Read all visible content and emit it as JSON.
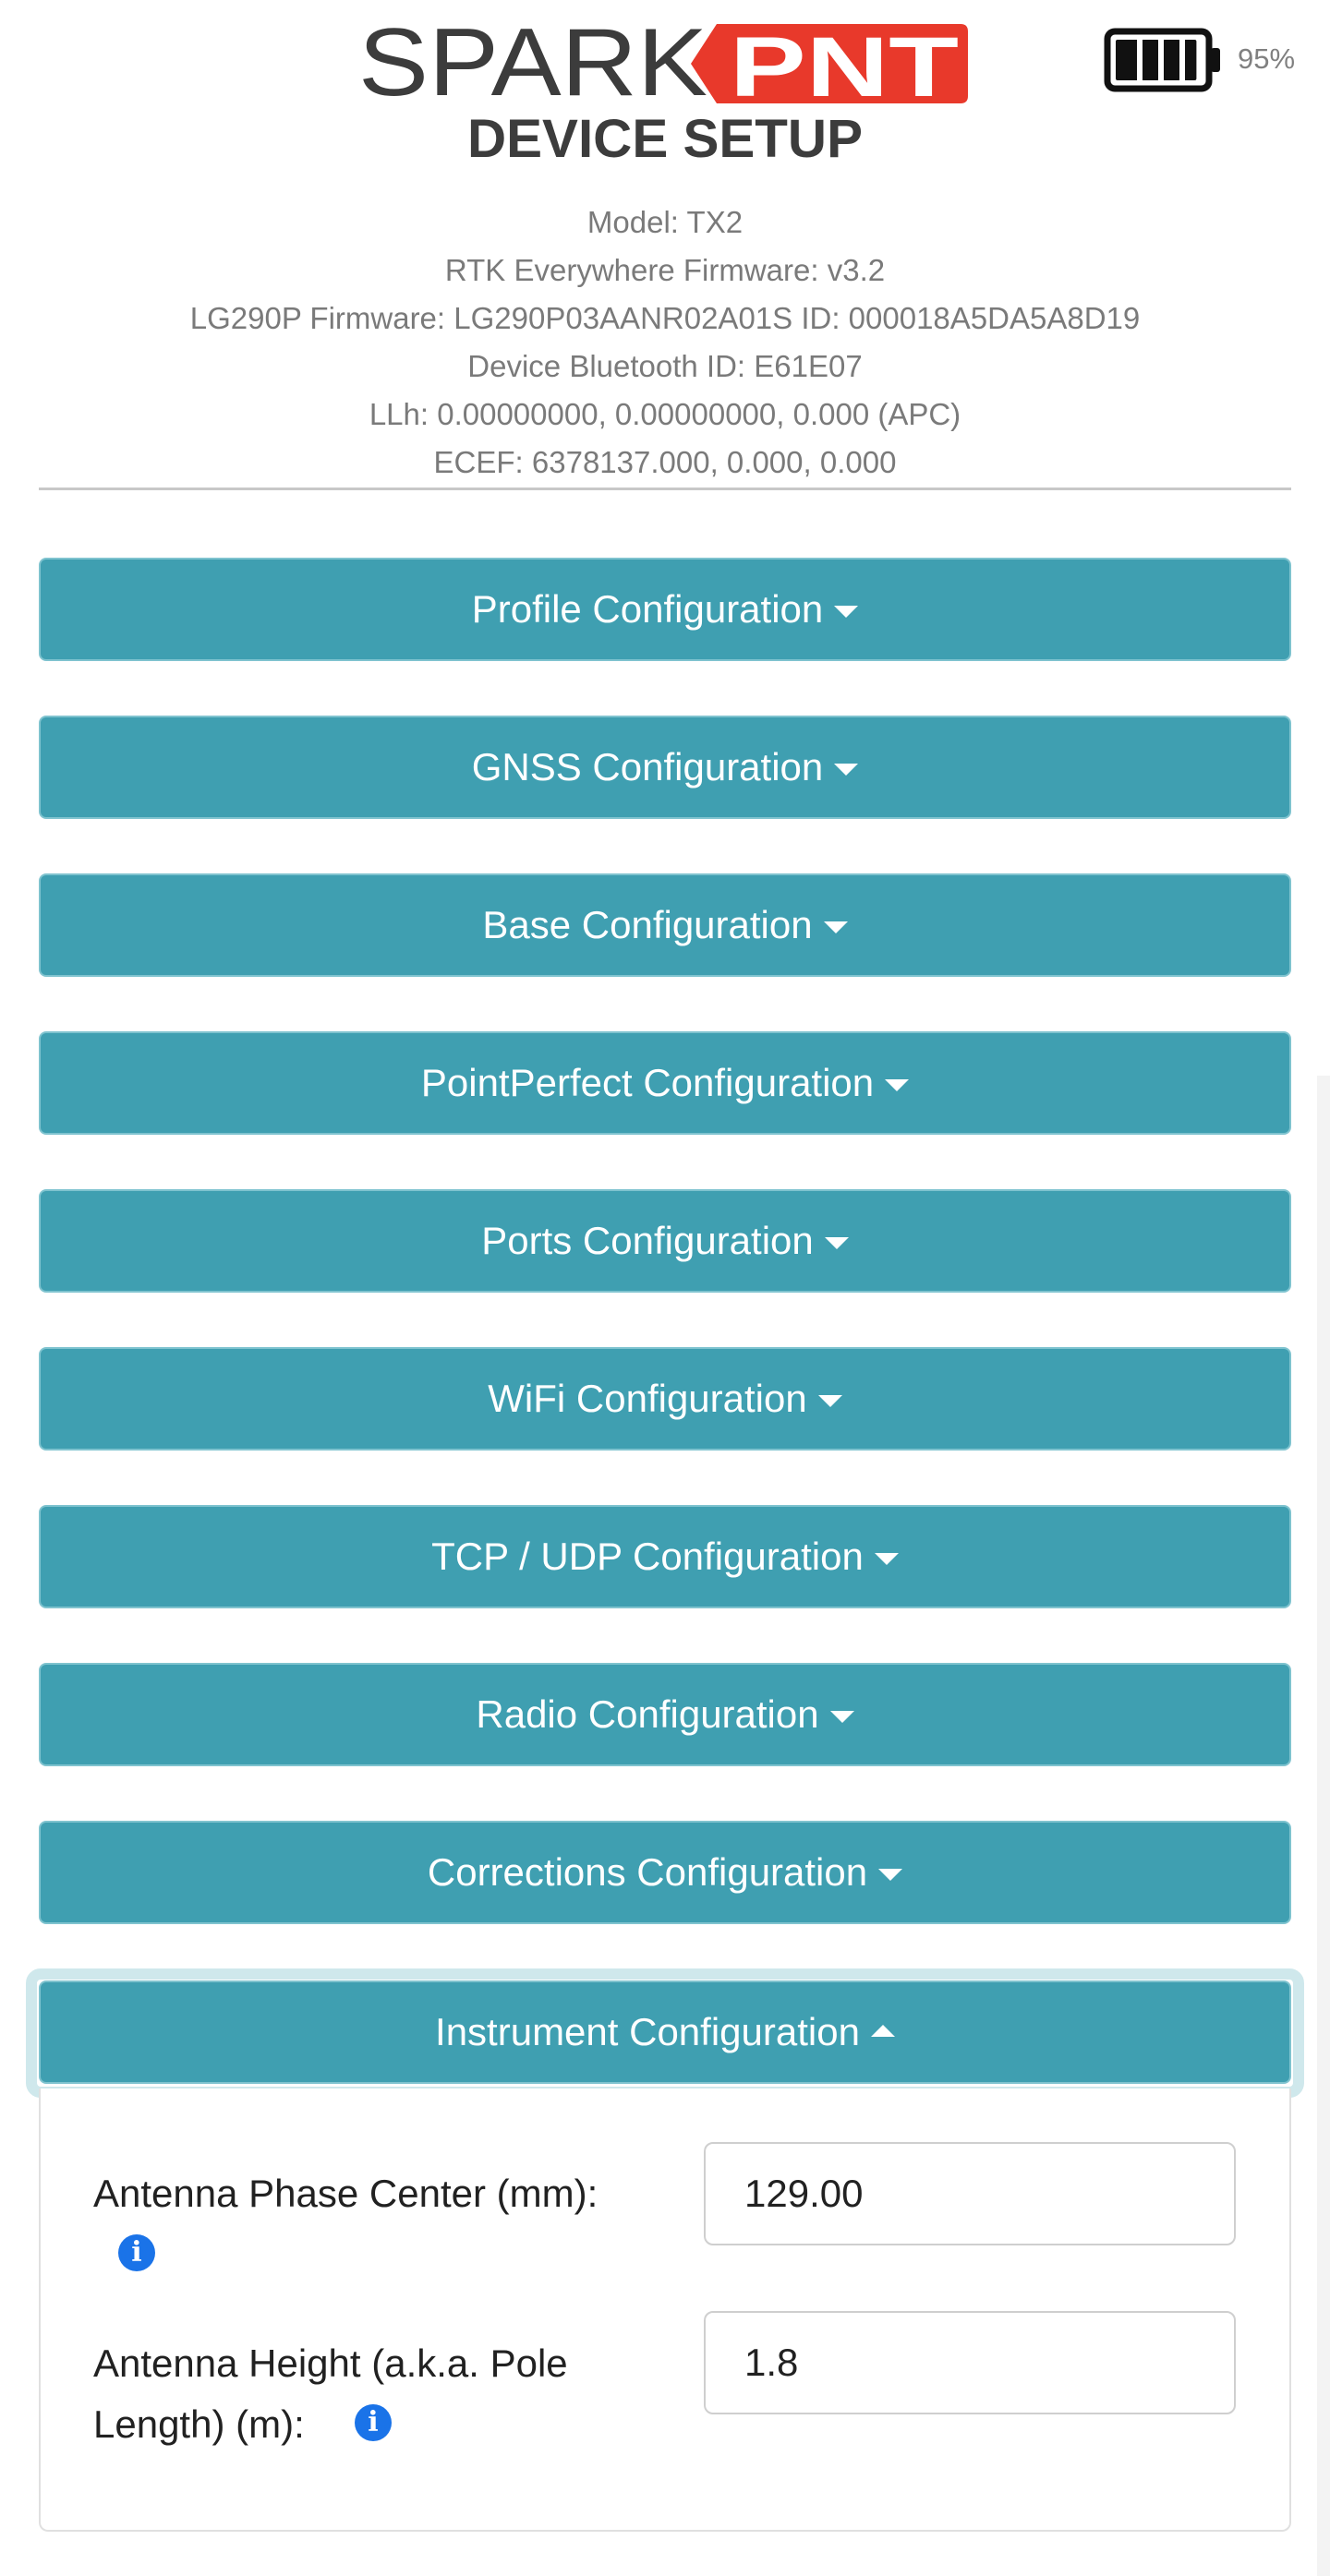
{
  "header": {
    "brand_left": "SPARK",
    "brand_right": "PNT",
    "subtitle": "DEVICE SETUP",
    "battery_percent": "95%",
    "battery_level": 0.95
  },
  "device_info": [
    "Model: TX2",
    "RTK Everywhere Firmware: v3.2",
    "LG290P Firmware: LG290P03AANR02A01S ID: 000018A5DA5A8D19",
    "Device Bluetooth ID: E61E07",
    "LLh: 0.00000000, 0.00000000, 0.000 (APC)",
    "ECEF: 6378137.000, 0.000, 0.000"
  ],
  "sections": [
    {
      "label": "Profile Configuration",
      "expanded": false
    },
    {
      "label": "GNSS Configuration",
      "expanded": false
    },
    {
      "label": "Base Configuration",
      "expanded": false
    },
    {
      "label": "PointPerfect Configuration",
      "expanded": false
    },
    {
      "label": "Ports Configuration",
      "expanded": false
    },
    {
      "label": "WiFi Configuration",
      "expanded": false
    },
    {
      "label": "TCP / UDP Configuration",
      "expanded": false
    },
    {
      "label": "Radio Configuration",
      "expanded": false
    },
    {
      "label": "Corrections Configuration",
      "expanded": false
    },
    {
      "label": "Instrument Configuration",
      "expanded": true
    }
  ],
  "instrument": {
    "antenna_phase_center": {
      "label": "Antenna Phase Center (mm):",
      "value": "129.00"
    },
    "antenna_height": {
      "label_line1": "Antenna Height (a.k.a. Pole",
      "label_line2": "Length) (m):",
      "value": "1.8"
    }
  },
  "icons": {
    "info": "info-circle-icon",
    "caret_down": "caret-down-icon",
    "caret_up": "caret-up-icon",
    "battery": "battery-icon"
  },
  "colors": {
    "section_button": "#3f9fb1",
    "brand_red": "#e8392b",
    "brand_dark": "#3c3c3c",
    "info_icon": "#1a73e8"
  }
}
